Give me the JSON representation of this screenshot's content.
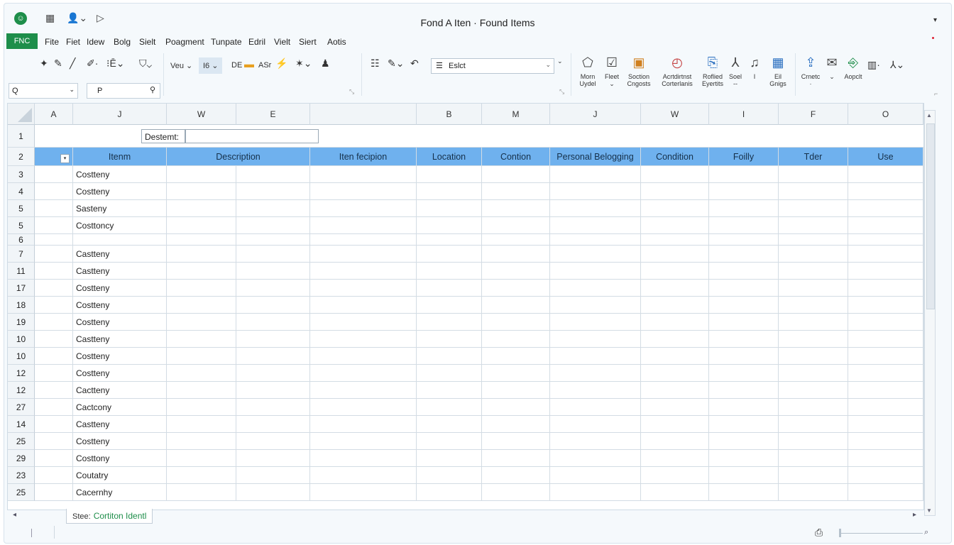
{
  "window": {
    "title": "Fond A Iten · Found Items",
    "file_tab": "FNC"
  },
  "menu": [
    "Fite",
    "Fiet",
    "Idew",
    "Bolg",
    "Sielt",
    "Poagment",
    "Tunpate",
    "Edril",
    "Vielt",
    "Siert",
    "Aotis"
  ],
  "ribbon": {
    "view_label": "Veu",
    "size_label": "I6",
    "de_label": "DE",
    "asr_label": "ASr",
    "font_value": "Eslct",
    "tiles": [
      {
        "line1": "Morn",
        "line2": "Uydel",
        "icon": "shape-icon"
      },
      {
        "line1": "Fleet",
        "line2": "⌄",
        "icon": "check-icon"
      },
      {
        "line1": "Soction",
        "line2": "Cngosts",
        "icon": "image-icon"
      },
      {
        "line1": "Acrtdirtnst",
        "line2": "Corterlanis",
        "icon": "clock-icon"
      },
      {
        "line1": "Roflied",
        "line2": "Eyertits",
        "icon": "doc-icon"
      },
      {
        "line1": "Soel",
        "line2": "--",
        "icon": "music-icon"
      },
      {
        "line1": "I",
        "line2": "",
        "icon": "music-icon"
      },
      {
        "line1": "Eil",
        "line2": "Gnigs",
        "icon": "grid-icon"
      },
      {
        "line1": "Crnetc",
        "line2": "·",
        "icon": "share-icon"
      },
      {
        "line1": "⌄",
        "line2": "",
        "icon": "mail-icon"
      },
      {
        "line1": "Aopclt",
        "line2": "",
        "icon": "chart-icon"
      }
    ]
  },
  "formula": {
    "name_box": "Q",
    "fx_value": "P"
  },
  "grid": {
    "col_letters": [
      "A",
      "J",
      "W",
      "E",
      "",
      "B",
      "M",
      "J",
      "W",
      "I",
      "F",
      "O"
    ],
    "destination_label": "Destemt:",
    "header_row_number": "2",
    "headers": [
      "Itenm",
      "Description",
      "",
      "Iten fecipion",
      "Location",
      "Contion",
      "Personal Belogging",
      "Condition",
      "Foilly",
      "Tder",
      "Use"
    ],
    "rows": [
      {
        "num": "1",
        "item": ""
      },
      {
        "num": "3",
        "item": "Costteny"
      },
      {
        "num": "4",
        "item": "Costteny"
      },
      {
        "num": "5",
        "item": "Sasteny"
      },
      {
        "num": "5",
        "item": "Costtoncy"
      },
      {
        "num": "6",
        "item": ""
      },
      {
        "num": "7",
        "item": "Castteny"
      },
      {
        "num": "11",
        "item": "Castteny"
      },
      {
        "num": "17",
        "item": "Costteny"
      },
      {
        "num": "18",
        "item": "Costteny"
      },
      {
        "num": "19",
        "item": "Costteny"
      },
      {
        "num": "10",
        "item": "Castteny"
      },
      {
        "num": "10",
        "item": "Costteny"
      },
      {
        "num": "12",
        "item": "Costteny"
      },
      {
        "num": "12",
        "item": "Cactteny"
      },
      {
        "num": "27",
        "item": "Cactcony"
      },
      {
        "num": "14",
        "item": "Castteny"
      },
      {
        "num": "25",
        "item": "Costteny"
      },
      {
        "num": "29",
        "item": "Costtony"
      },
      {
        "num": "23",
        "item": "Coutatry"
      },
      {
        "num": "25",
        "item": "Cacernhy"
      }
    ]
  },
  "sheet_tab": {
    "prefix": "Stee:",
    "name": "Cortiton Identl"
  },
  "colors": {
    "accent": "#1e8e4a",
    "header_fill": "#6fb1ee"
  }
}
